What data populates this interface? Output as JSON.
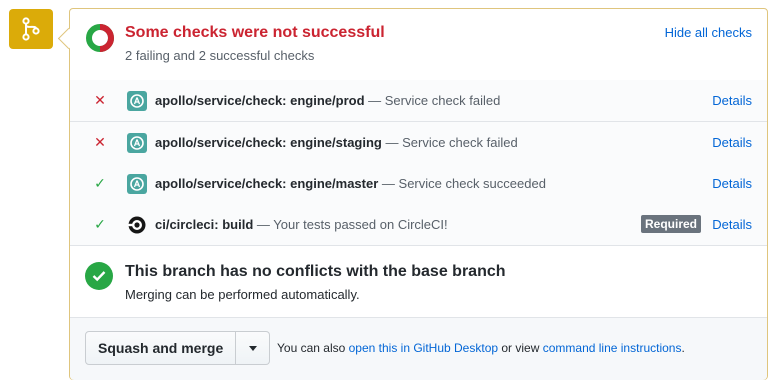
{
  "merge_icon": "git-merge-icon",
  "header": {
    "title": "Some checks were not successful",
    "subtitle": "2 failing and 2 successful checks",
    "hide_label": "Hide all checks"
  },
  "checks": [
    {
      "status": "fail",
      "icon": "apollo-icon",
      "context": "apollo/service/check: engine/prod",
      "description": "— Service check failed",
      "details_label": "Details"
    },
    {
      "status": "fail",
      "icon": "apollo-icon",
      "context": "apollo/service/check: engine/staging",
      "description": "— Service check failed",
      "details_label": "Details"
    },
    {
      "status": "success",
      "icon": "apollo-icon",
      "context": "apollo/service/check: engine/master",
      "description": "— Service check succeeded",
      "details_label": "Details"
    },
    {
      "status": "success",
      "icon": "circleci-icon",
      "context": "ci/circleci: build",
      "description": "— Your tests passed on CircleCI!",
      "required_label": "Required",
      "details_label": "Details"
    }
  ],
  "branch": {
    "title": "This branch has no conflicts with the base branch",
    "subtitle": "Merging can be performed automatically."
  },
  "merge": {
    "button_label": "Squash and merge",
    "note_prefix": "You can also ",
    "desktop_link": "open this in GitHub Desktop",
    "note_middle": " or view ",
    "cli_link": "command line instructions",
    "note_suffix": "."
  },
  "colors": {
    "fail": "#cb2431",
    "success": "#28a745",
    "link": "#0366d6",
    "merge_tile": "#dbab09"
  }
}
